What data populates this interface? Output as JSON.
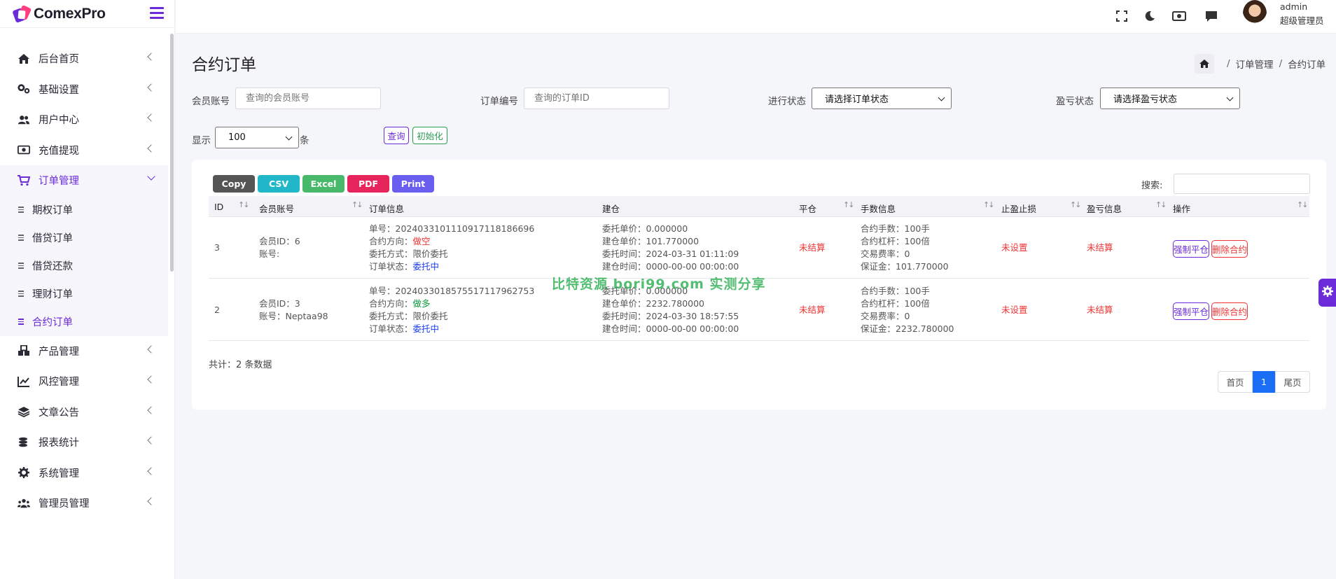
{
  "app": {
    "name": "ComexPro"
  },
  "sidebar": {
    "items": [
      {
        "label": "后台首页",
        "icon": "home-icon"
      },
      {
        "label": "基础设置",
        "icon": "gears-icon"
      },
      {
        "label": "用户中心",
        "icon": "users-icon"
      },
      {
        "label": "充值提现",
        "icon": "money-icon"
      },
      {
        "label": "订单管理",
        "icon": "cart-icon",
        "active": true
      },
      {
        "label": "产品管理",
        "icon": "cubes-icon"
      },
      {
        "label": "风控管理",
        "icon": "chart-line-icon"
      },
      {
        "label": "文章公告",
        "icon": "layers-icon"
      },
      {
        "label": "报表统计",
        "icon": "coins-icon"
      },
      {
        "label": "系统管理",
        "icon": "gear-icon"
      },
      {
        "label": "管理员管理",
        "icon": "user-group-icon"
      }
    ],
    "subitems": [
      "期权订单",
      "借贷订单",
      "借贷还款",
      "理财订单",
      "合约订单"
    ],
    "active_subitem": "合约订单"
  },
  "header": {
    "icons": [
      "fullscreen-icon",
      "moon-icon",
      "money-icon",
      "chat-icon"
    ],
    "user": {
      "name": "admin",
      "role": "超级管理员"
    }
  },
  "page": {
    "title": "合约订单",
    "breadcrumb": [
      "订单管理",
      "合约订单"
    ],
    "breadcrumb_sep": "/"
  },
  "filters": {
    "member_label": "会员账号",
    "member_placeholder": "查询的会员账号",
    "order_label": "订单编号",
    "order_placeholder": "查询的订单ID",
    "status_label": "进行状态",
    "status_value": "请选择订单状态",
    "pnl_label": "盈亏状态",
    "pnl_value": "请选择盈亏状态",
    "show_label": "显示",
    "show_value": "100",
    "show_unit": "条",
    "query_btn": "查询",
    "reset_btn": "初始化"
  },
  "toolbar": {
    "buttons": [
      {
        "label": "Copy",
        "color": "#555555"
      },
      {
        "label": "CSV",
        "color": "#20b7c9"
      },
      {
        "label": "Excel",
        "color": "#48b86a"
      },
      {
        "label": "PDF",
        "color": "#e8245c"
      },
      {
        "label": "Print",
        "color": "#6a5ef0"
      }
    ],
    "search_label": "搜索:"
  },
  "table": {
    "columns": [
      "ID",
      "会员账号",
      "订单信息",
      "建仓",
      "平仓",
      "手数信息",
      "止盈止损",
      "盈亏信息",
      "操作"
    ],
    "rows": [
      {
        "id": "3",
        "member": [
          "会员ID：6",
          "账号:"
        ],
        "order": {
          "no": "单号：20240331011109171181866​96",
          "direction_label": "合约方向：",
          "direction": "做空",
          "mode": "委托方式：限价委托",
          "status_label": "订单状态：",
          "status": "委托中"
        },
        "open": [
          "委托单价：0.000000",
          "建仓单价：101.770000",
          "委托时间：2024-03-31 01:11:09",
          "建仓时间：0000-00-00 00:00:00"
        ],
        "close": "未结算",
        "lots": [
          "合约手数：100手",
          "合约杠杆：100倍",
          "交易费率：0",
          "保证金：101.770000"
        ],
        "tpsl": "未设置",
        "pnl": "未结算",
        "actions": [
          "强制平仓",
          "删除合约"
        ]
      },
      {
        "id": "2",
        "member": [
          "会员ID：3",
          "账号：Neptaa98"
        ],
        "order": {
          "no": "单号：20240330185755171179627​53",
          "direction_label": "合约方向：",
          "direction": "做多",
          "mode": "委托方式：限价委托",
          "status_label": "订单状态：",
          "status": "委托中"
        },
        "open": [
          "委托单价：0.000000",
          "建仓单价：2232.780000",
          "委托时间：2024-03-30 18:57:55",
          "建仓时间：0000-00-00 00:00:00"
        ],
        "close": "未结算",
        "lots": [
          "合约手数：100手",
          "合约杠杆：100倍",
          "交易费率：0",
          "保证金：2232.780000"
        ],
        "tpsl": "未设置",
        "pnl": "未结算",
        "actions": [
          "强制平仓",
          "删除合约"
        ]
      }
    ],
    "total": "共计：2 条数据"
  },
  "pagination": {
    "first": "首页",
    "current": "1",
    "last": "尾页"
  },
  "watermark": "比特资源 bori99.com 实测分享",
  "colors": {
    "accent": "#6b2bd9",
    "red": "#e33333",
    "blue": "#1a3df0",
    "green": "#0a9a3a",
    "page_active": "#1a6ef5"
  }
}
